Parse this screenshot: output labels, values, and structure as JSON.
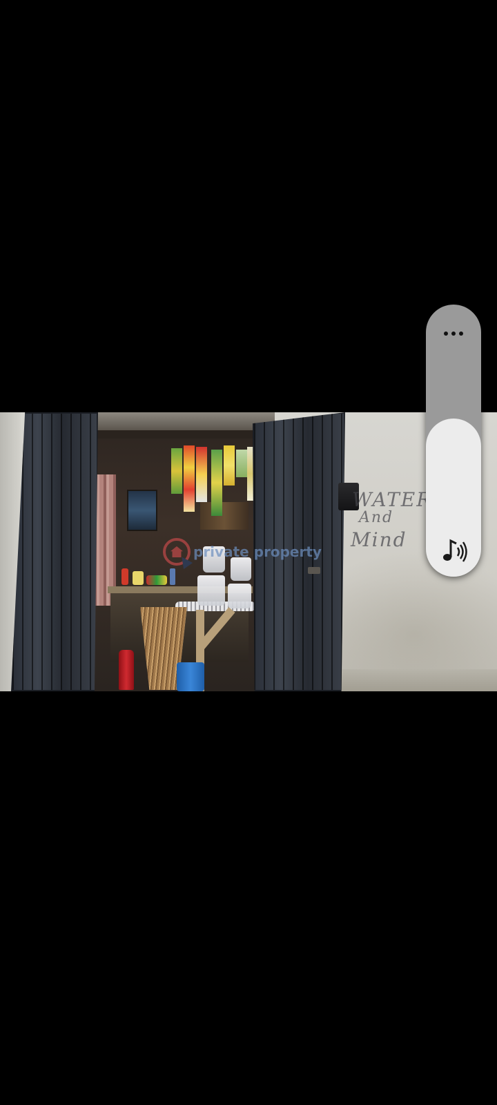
{
  "video": {
    "watermark_text": "private property",
    "wall_writing": [
      "WATER",
      "And",
      "Mind"
    ]
  },
  "volume": {
    "level": 0.58,
    "more_options_icon": "more-horizontal-icon",
    "stream_icon": "music-note-icon",
    "panel_color": "#9a9a9a",
    "fill_color": "#ececec"
  }
}
